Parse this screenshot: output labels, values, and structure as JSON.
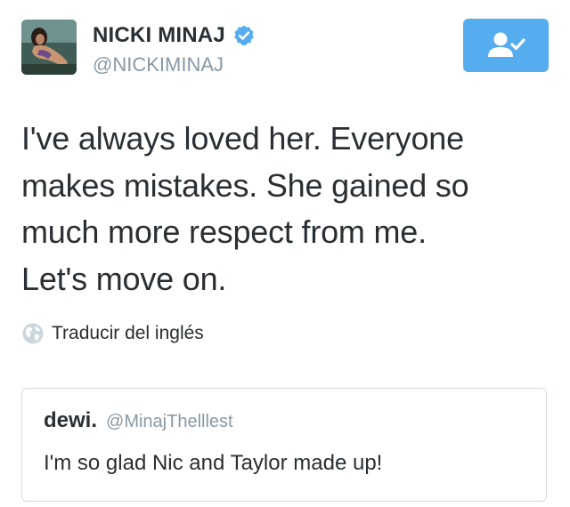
{
  "author": {
    "display_name": "NICKI MINAJ",
    "handle": "@NICKIMINAJ",
    "verified_icon": "verified-badge-icon",
    "avatar_icon": "profile-photo"
  },
  "follow_button": {
    "icon": "following-user-check-icon",
    "state": "following",
    "color": "#55acee"
  },
  "tweet": {
    "lines": [
      "I've always loved her. Everyone",
      "makes mistakes. She gained so",
      "much more respect from me.",
      "Let's move on."
    ]
  },
  "translate": {
    "icon": "globe-icon",
    "label": "Traducir del inglés"
  },
  "quoted_tweet": {
    "display_name": "dewi.",
    "handle": "@MinajThelllest",
    "text": "I'm so glad Nic and Taylor made up!"
  },
  "colors": {
    "text": "#292f33",
    "secondary": "#8899a6",
    "accent": "#55acee",
    "border": "#d8dde1"
  }
}
